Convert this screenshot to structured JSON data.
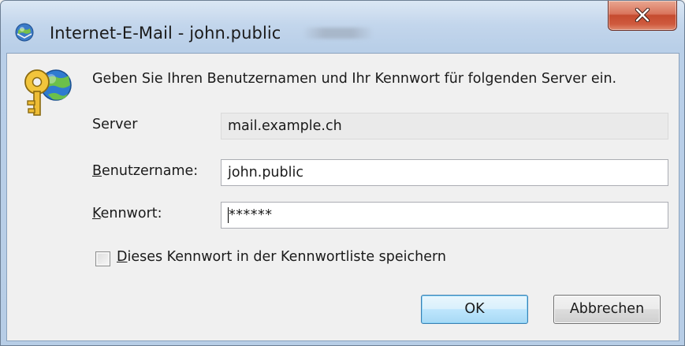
{
  "window": {
    "title": "Internet-E-Mail - john.public",
    "close_label": "X",
    "title_icon": "outlook-app-icon",
    "colors": {
      "frame": "#b9cfe8",
      "client": "#f0f0f0",
      "close_button": "#c54b2f",
      "ok_button_border": "#3c7fb1"
    }
  },
  "dialog": {
    "icon": "key-globe-icon",
    "prompt": "Geben Sie Ihren Benutzernamen und Ihr Kennwort für folgenden Server ein.",
    "server_label": "Server",
    "server_value": "mail.example.ch",
    "username_label_accel": "B",
    "username_label_rest": "enutzername:",
    "username_value": "john.public",
    "password_label_accel": "K",
    "password_label_rest": "ennwort:",
    "password_value": "******",
    "save_checkbox_checked": false,
    "save_label_accel": "D",
    "save_label_rest": "ieses Kennwort in der Kennwortliste speichern",
    "ok_label": "OK",
    "cancel_label": "Abbrechen"
  }
}
